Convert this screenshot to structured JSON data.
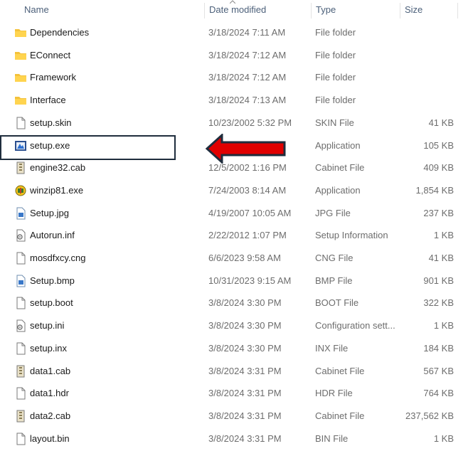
{
  "columns": {
    "name": "Name",
    "date_modified": "Date modified",
    "type": "Type",
    "size": "Size"
  },
  "files": [
    {
      "name": "Dependencies",
      "date": "3/18/2024 7:11 AM",
      "type": "File folder",
      "size": "",
      "icon": "folder-icon"
    },
    {
      "name": "EConnect",
      "date": "3/18/2024 7:12 AM",
      "type": "File folder",
      "size": "",
      "icon": "folder-icon"
    },
    {
      "name": "Framework",
      "date": "3/18/2024 7:12 AM",
      "type": "File folder",
      "size": "",
      "icon": "folder-icon"
    },
    {
      "name": "Interface",
      "date": "3/18/2024 7:13 AM",
      "type": "File folder",
      "size": "",
      "icon": "folder-icon"
    },
    {
      "name": "setup.skin",
      "date": "10/23/2002 5:32 PM",
      "type": "SKIN File",
      "size": "41 KB",
      "icon": "file-icon"
    },
    {
      "name": "setup.exe",
      "date": "",
      "type": "Application",
      "size": "105 KB",
      "icon": "setup-exe-icon"
    },
    {
      "name": "engine32.cab",
      "date": "12/5/2002 1:16 PM",
      "type": "Cabinet File",
      "size": "409 KB",
      "icon": "cabinet-icon"
    },
    {
      "name": "winzip81.exe",
      "date": "7/24/2003 8:14 AM",
      "type": "Application",
      "size": "1,854 KB",
      "icon": "winzip-icon"
    },
    {
      "name": "Setup.jpg",
      "date": "4/19/2007 10:05 AM",
      "type": "JPG File",
      "size": "237 KB",
      "icon": "image-file-icon"
    },
    {
      "name": "Autorun.inf",
      "date": "2/22/2012 1:07 PM",
      "type": "Setup Information",
      "size": "1 KB",
      "icon": "settings-file-icon"
    },
    {
      "name": "mosdfxcy.cng",
      "date": "6/6/2023 9:58 AM",
      "type": "CNG File",
      "size": "41 KB",
      "icon": "file-icon"
    },
    {
      "name": "Setup.bmp",
      "date": "10/31/2023 9:15 AM",
      "type": "BMP File",
      "size": "901 KB",
      "icon": "image-file-icon"
    },
    {
      "name": "setup.boot",
      "date": "3/8/2024 3:30 PM",
      "type": "BOOT File",
      "size": "322 KB",
      "icon": "file-icon"
    },
    {
      "name": "setup.ini",
      "date": "3/8/2024 3:30 PM",
      "type": "Configuration sett...",
      "size": "1 KB",
      "icon": "settings-file-icon"
    },
    {
      "name": "setup.inx",
      "date": "3/8/2024 3:30 PM",
      "type": "INX File",
      "size": "184 KB",
      "icon": "file-icon"
    },
    {
      "name": "data1.cab",
      "date": "3/8/2024 3:31 PM",
      "type": "Cabinet File",
      "size": "567 KB",
      "icon": "cabinet-icon"
    },
    {
      "name": "data1.hdr",
      "date": "3/8/2024 3:31 PM",
      "type": "HDR File",
      "size": "764 KB",
      "icon": "file-icon"
    },
    {
      "name": "data2.cab",
      "date": "3/8/2024 3:31 PM",
      "type": "Cabinet File",
      "size": "237,562 KB",
      "icon": "cabinet-icon"
    },
    {
      "name": "layout.bin",
      "date": "3/8/2024 3:31 PM",
      "type": "BIN File",
      "size": "1 KB",
      "icon": "file-icon"
    }
  ],
  "annotation": {
    "highlight_color": "#1f2d3d",
    "arrow_color": "#e00000",
    "arrow_outline": "#1f2d3d"
  }
}
